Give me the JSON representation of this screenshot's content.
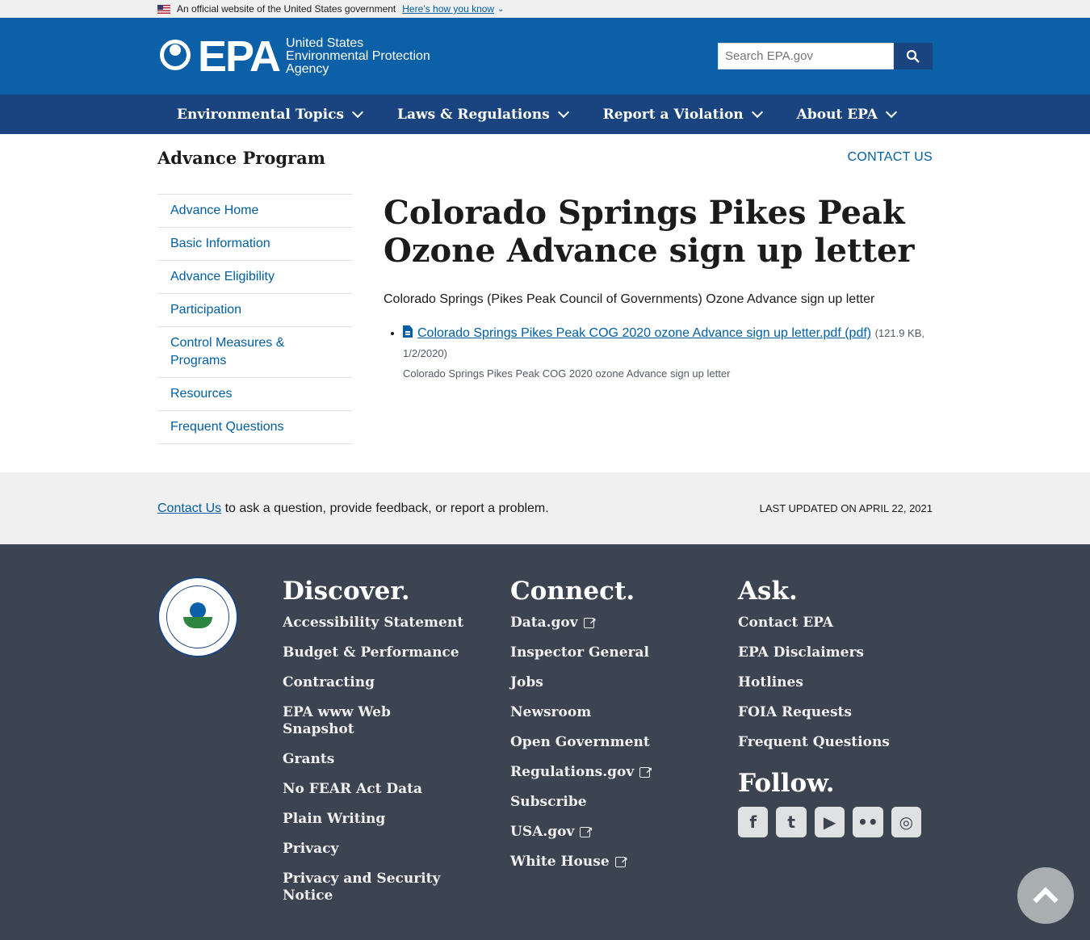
{
  "gov_banner": {
    "text": "An official website of the United States government",
    "link": "Here’s how you know"
  },
  "header": {
    "logo_text": "EPA",
    "logo_sub_1": "United States",
    "logo_sub_2": "Environmental Protection",
    "logo_sub_3": "Agency",
    "search_placeholder": "Search EPA.gov"
  },
  "nav": {
    "items": [
      {
        "label": "Environmental Topics"
      },
      {
        "label": "Laws & Regulations"
      },
      {
        "label": "Report a Violation"
      },
      {
        "label": "About EPA"
      }
    ]
  },
  "page": {
    "program": "Advance Program",
    "contact": "CONTACT US"
  },
  "sidenav": {
    "items": [
      {
        "label": "Advance Home"
      },
      {
        "label": "Basic Information"
      },
      {
        "label": "Advance Eligibility"
      },
      {
        "label": "Participation"
      },
      {
        "label": "Control Measures & Programs"
      },
      {
        "label": "Resources"
      },
      {
        "label": "Frequent Questions"
      }
    ]
  },
  "content": {
    "title": "Colorado Springs Pikes Peak Ozone Advance sign up letter",
    "lead": "Colorado Springs (Pikes Peak Council of Governments) Ozone Advance sign up letter",
    "doc_link": "Colorado Springs Pikes Peak COG 2020 ozone Advance sign up letter.pdf (pdf)",
    "doc_meta": "(121.9 KB, 1/2/2020)",
    "doc_desc": "Colorado Springs Pikes Peak COG 2020 ozone Advance sign up letter"
  },
  "feedback": {
    "link": "Contact Us",
    "text": " to ask a question, provide feedback, or report a problem.",
    "updated": "LAST UPDATED ON APRIL 22, 2021"
  },
  "footer": {
    "discover": {
      "heading": "Discover.",
      "links": [
        "Accessibility Statement",
        "Budget & Performance",
        "Contracting",
        "EPA www Web Snapshot",
        "Grants",
        "No FEAR Act Data",
        "Plain Writing",
        "Privacy",
        "Privacy and Security Notice"
      ]
    },
    "connect": {
      "heading": "Connect.",
      "links": [
        "Data.gov",
        "Inspector General",
        "Jobs",
        "Newsroom",
        "Open Government",
        "Regulations.gov",
        "Subscribe",
        "USA.gov",
        "White House"
      ]
    },
    "ask": {
      "heading": "Ask.",
      "links": [
        "Contact EPA",
        "EPA Disclaimers",
        "Hotlines",
        "FOIA Requests",
        "Frequent Questions"
      ]
    },
    "follow": {
      "heading": "Follow.",
      "icons": [
        "facebook-icon",
        "twitter-icon",
        "youtube-icon",
        "flickr-icon",
        "instagram-icon"
      ]
    }
  },
  "colors": {
    "header_blue": "#0b60a8",
    "nav_blue": "#1a4480",
    "footer_gray": "#3d4451",
    "link_blue": "#005ea2"
  }
}
